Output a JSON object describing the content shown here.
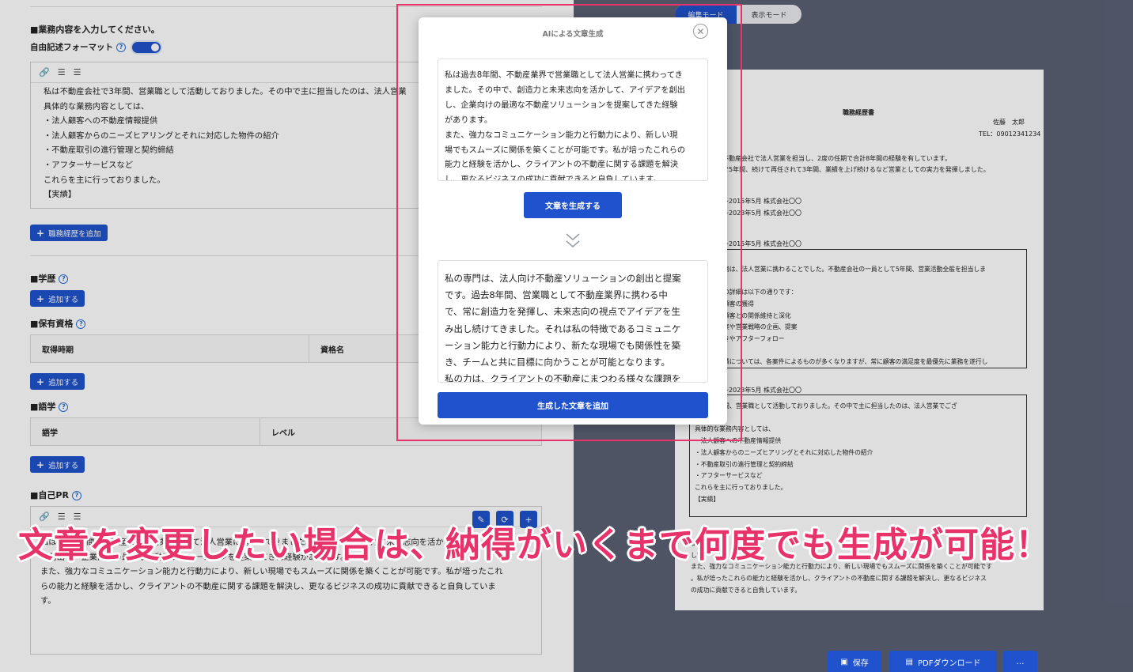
{
  "left": {
    "job_heading": "■業務内容を入力してください。",
    "free_format_label": "自由記述フォーマット",
    "job_editor_lines": [
      "私は不動産会社で3年間、営業職として活動しておりました。その中で主に担当したのは、法人営業",
      "具体的な業務内容としては、",
      "・法人顧客への不動産情報提供",
      "・法人顧客からのニーズヒアリングとそれに対応した物件の紹介",
      "・不動産取引の進行管理と契約締結",
      "・アフターサービスなど",
      "これらを主に行っておりました。",
      "【実績】"
    ],
    "add_career_label": "職務経歴を追加",
    "education_heading": "■学歴",
    "add_label": "追加する",
    "qualification_heading": "■保有資格",
    "qualification_columns": [
      "取得時期",
      "資格名"
    ],
    "language_heading": "■語学",
    "language_columns": [
      "語学",
      "レベル"
    ],
    "pr_heading": "■自己PR",
    "pr_editor_lines": [
      "私は過去8年間、不動産業界で営業職として法人営業に携わってきました。その中で、創造力と未来志向を活か",
      "を創出し、企業向けの最適な不動産ソリューションを提案してきた経験があります。",
      "また、強力なコミュニケーション能力と行動力により、新しい現場でもスムーズに関係を築くことが可能です。私が培ったこれ",
      "らの能力と経験を活かし、クライアントの不動産に関する課題を解決し、更なるビジネスの成功に貢献できると自負していま",
      "す。"
    ]
  },
  "mode": {
    "edit": "編集モード",
    "view": "表示モード"
  },
  "paper": {
    "title": "職務経歴書",
    "name": "佐藤　太郎",
    "tel": "TEL：09012341234",
    "summary": [
      "不動産会社で法人営業を担当し、2度の任期で合計8年間の経験を有しています。",
      "で5年間、続けて再任されて3年間、業績を上げ続けるなど営業としての実力を発揮しました。"
    ],
    "history": [
      "～2015年5月 株式会社〇〇",
      "～2023年5月 株式会社〇〇"
    ],
    "block1_head": "～2015年5月 株式会社〇〇",
    "block1_lines": [
      "】",
      "務は、法人営業に携わることでした。不動産会社の一員として5年間、営業活動全般を担当しま",
      "",
      "の詳細は以下の通りです：",
      "顧客の獲得",
      "顧客との関係維持と深化",
      "案や営業戦略の企画、提案",
      "きやアフターフォロー",
      "",
      "績については、各案件によるものが多くなりますが、常に顧客の満足度を最優先に業務を遂行し"
    ],
    "block1_tail": "。",
    "block2_head": "～2023年5月 株式会社〇〇",
    "block2_lines": [
      "会社で3年間、営業職として活動しておりました。その中で主に担当したのは、法人営業でござ",
      "いました。",
      "具体的な業務内容としては、",
      "・法人顧客への不動産情報提供",
      "・法人顧客からのニーズヒアリングとそれに対応した物件の紹介",
      "・不動産取引の進行管理と契約締結",
      "・アフターサービスなど",
      "これらを主に行っておりました。",
      "【実績】"
    ],
    "pr_lines": [
      "私は",
      "して",
      "また、強力なコミュニケーション能力と行動力により、新しい現場でもスムーズに関係を築くことが可能です",
      "。私が培ったこれらの能力と経験を活かし、クライアントの不動産に関する課題を解決し、更なるビジネス",
      "の成功に貢献できると自負しています。"
    ]
  },
  "modal": {
    "title": "AIによる文章生成",
    "input_text": "私は過去8年間、不動産業界で営業職として法人営業に携わってき\nました。その中で、創造力と未来志向を活かして、アイデアを創出\nし、企業向けの最適な不動産ソリューションを提案してきた経験\nがあります。\nまた、強力なコミュニケーション能力と行動力により、新しい現\n場でもスムーズに関係を築くことが可能です。私が培ったこれらの\n能力と経験を活かし、クライアントの不動産に関する課題を解決\nし、更なるビジネスの成功に貢献できると自負しています。",
    "generate_label": "文章を生成する",
    "output_text": "私の専門は、法人向け不動産ソリューションの創出と提案\nです。過去8年間、営業職として不動産業界に携わる中\nで、常に創造力を発揮し、未来志向の視点でアイデアを生\nみ出し続けてきました。それは私の特徴であるコミュニケ\nーション能力と行動力により、新たな現場でも関係性を築\nき、チームと共に目標に向かうことが可能となります。\n私の力は、クライアントの不動産にまつわる様々な課題を",
    "add_label": "生成した文章を追加"
  },
  "caption": "文章を変更したい場合は、納得がいくまで何度でも生成が可能！",
  "bottom": {
    "save": "保存",
    "pdf": "PDFダウンロード",
    "more": "…"
  },
  "colors": {
    "primary": "#1f52cc",
    "highlight": "#e8336a",
    "background": "#5b6175"
  }
}
